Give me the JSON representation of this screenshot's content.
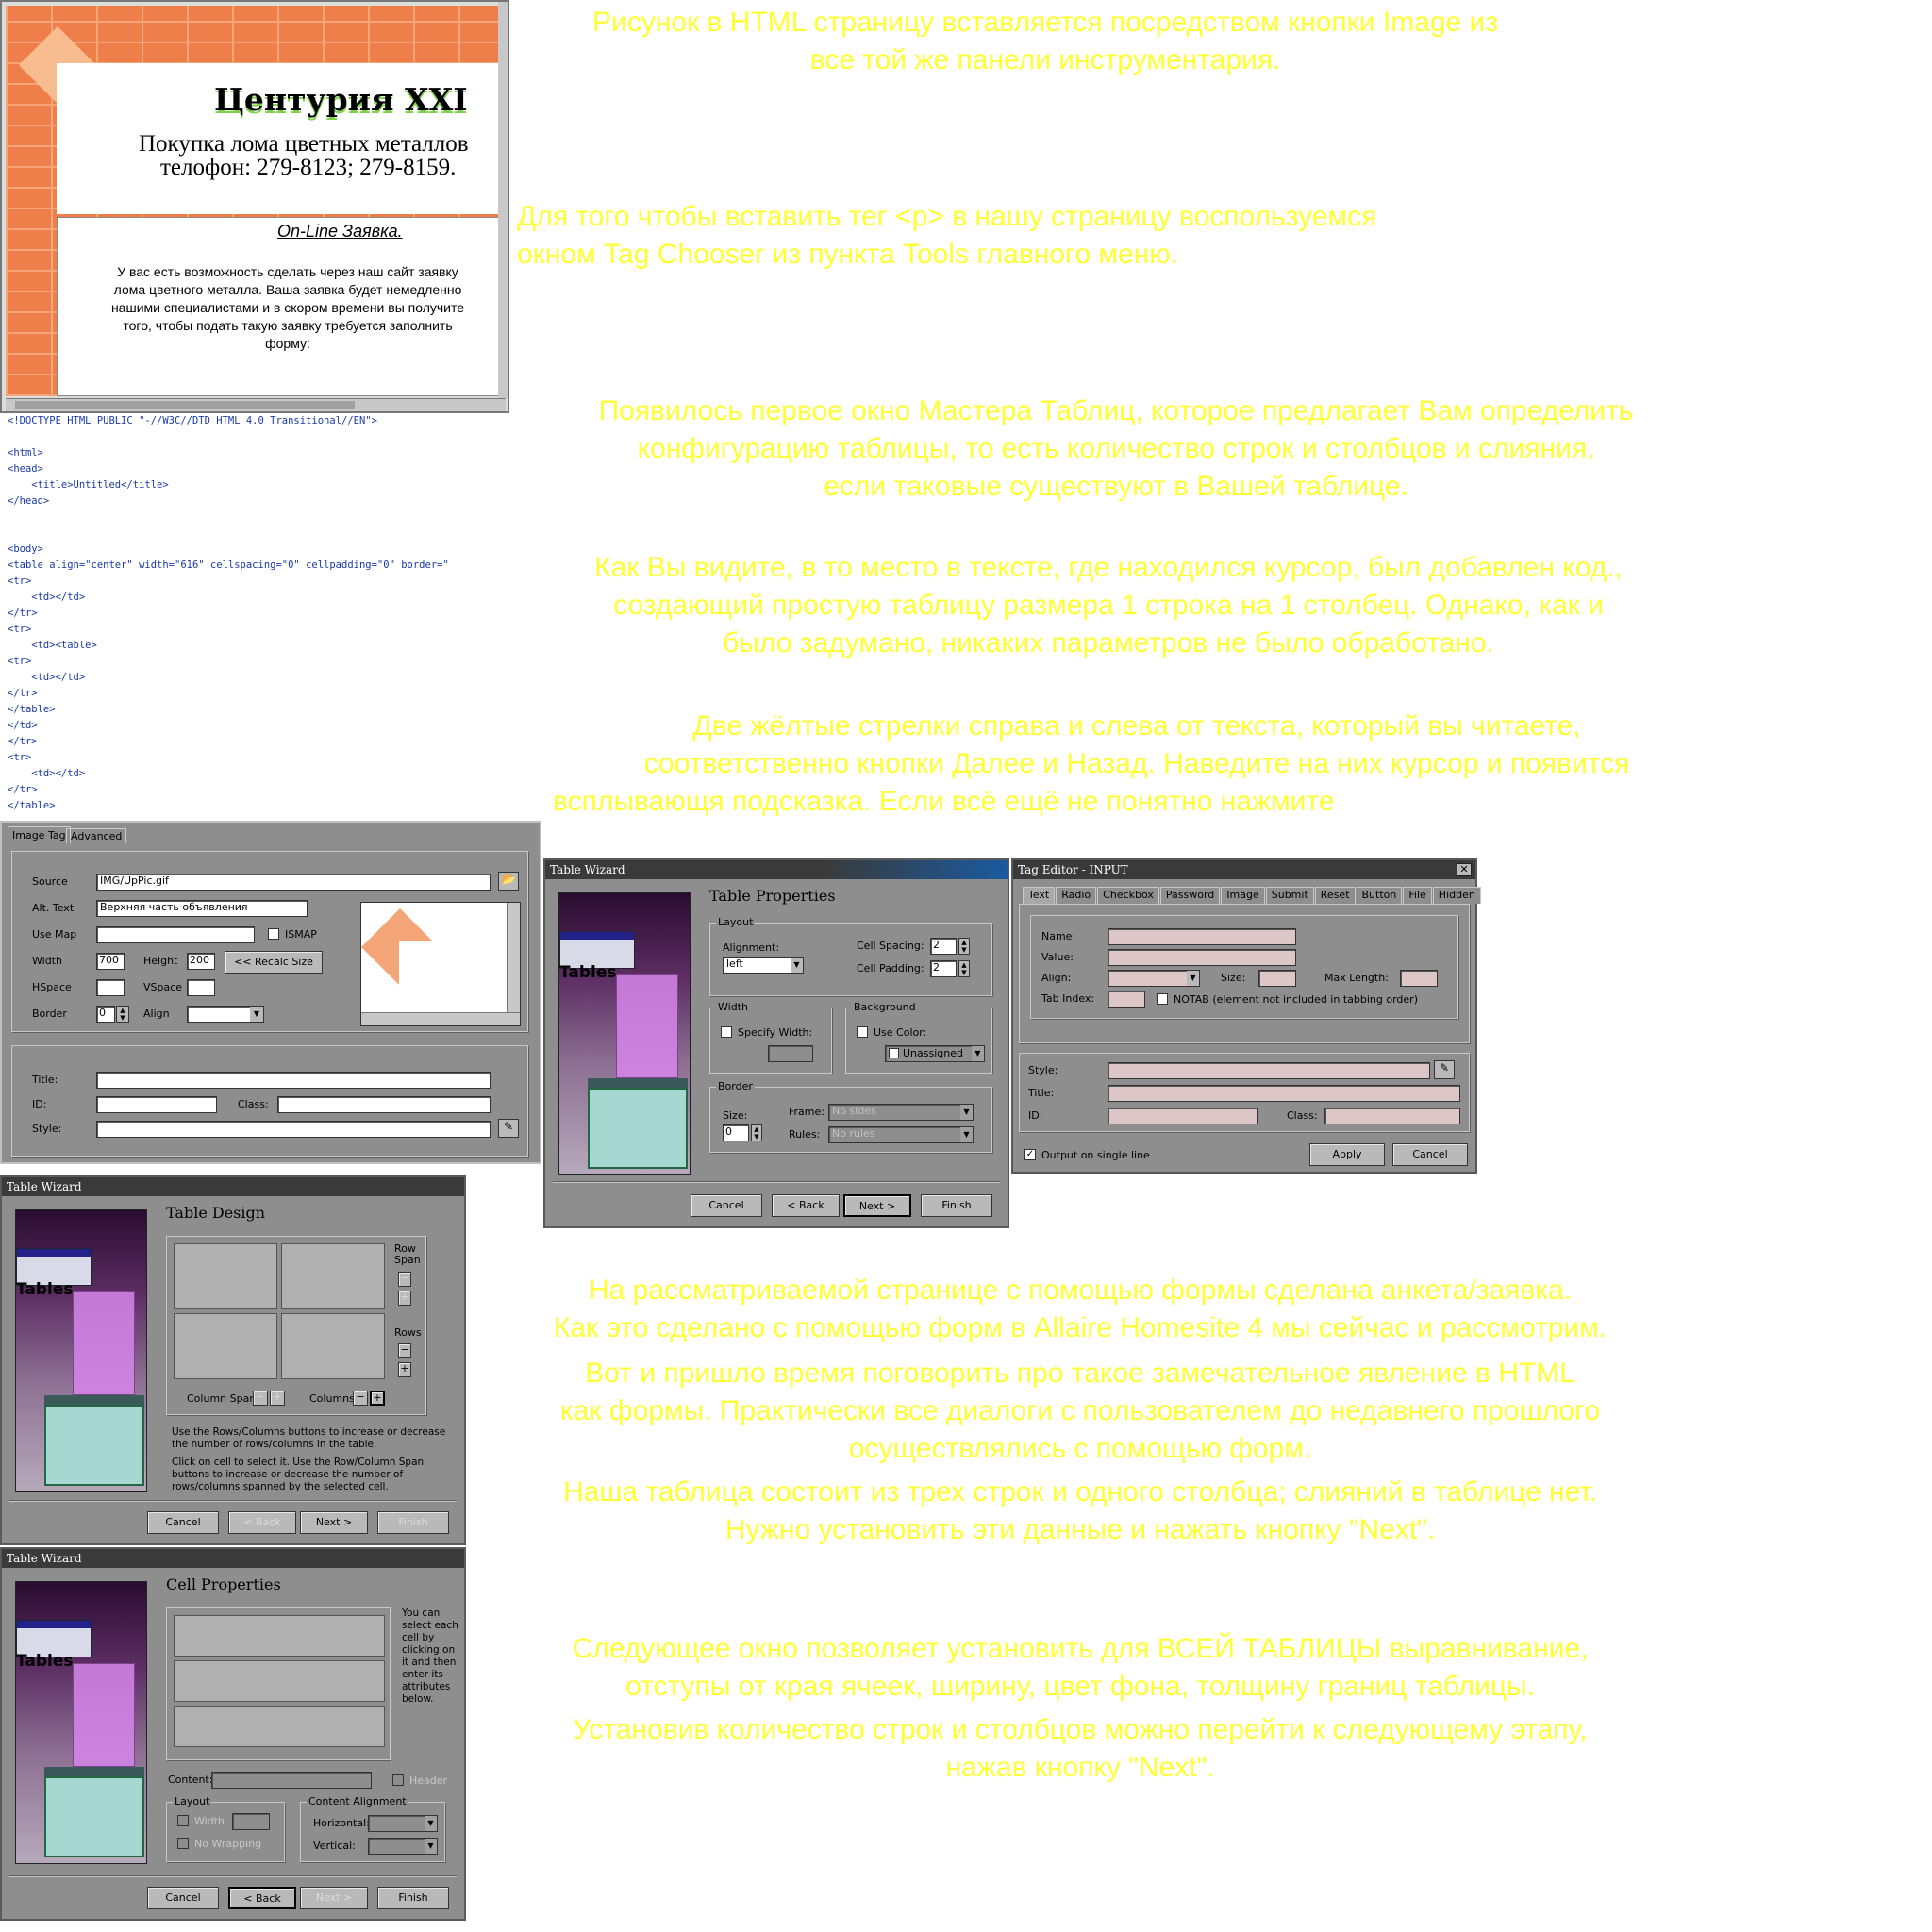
{
  "yellow_text": [
    [
      "Рисунок в HTML страницу вставляется посредством  кнопки Image из",
      "все той же панели инструментария."
    ],
    [
      "Для того чтобы вставить тег <p>  в нашу страницу воспользуемся",
      "окном Tag Chooser из пункта   Tools главного меню."
    ],
    [
      "Появилось первое окно Мастера Таблиц, которое предлагает Вам определить",
      "конфигурацию таблицы, то есть количество строк и столбцов и слияния,",
      "если таковые существуют в Вашей таблице."
    ],
    [
      "Как Вы видите, в то место в тексте, где находился курсор, был добавлен код.,",
      "создающий простую таблицу размера 1 строка на 1 столбец. Однако, как и",
      "было задумано, никаких параметров не было обработано."
    ],
    [
      "Две жёлтые стрелки справа и слева от текста, который вы читаете,",
      "соответственно кнопки Далее и Назад. Наведите на них курсор и появится",
      "всплывающя подсказка. Если  всё ещё не понятно нажмите"
    ],
    [
      "На рассматриваемой странице с помощью формы сделана анкета/заявка.",
      "Как это сделано с помощью форм в Allaire Homesite 4 мы сейчас и рассмотрим."
    ],
    [
      "Вот и пришло время поговорить про такое замечательное явление в HTML",
      "как формы. Практически все диалоги с пользователем до недавнего прошлого",
      "осуществлялись с помощью форм."
    ],
    [
      "Наша таблица состоит из трех строк и одного столбца; слияний в таблице нет.",
      "Нужно установить эти данные и нажать кнопку \"Next\"."
    ],
    [
      "Следующее окно позволяет установить для ВСЕЙ ТАБЛИЦЫ выравнивание,",
      "отступы от края ячеек, ширину, цвет фона, толщину границ таблицы."
    ],
    [
      "Установив количество строк и столбцов можно перейти к следующему этапу,",
      "нажав кнопку \"Next\"."
    ]
  ],
  "preview": {
    "title": "Центурия XXI",
    "line1": "Покупка лома цветных металлов",
    "line2": "телофон: 279-8123; 279-8159.",
    "link": "On-Line Заявка.",
    "body": [
      "У вас есть возможность сделать через наш сайт заявку",
      "лома цветного металла. Ваша заявка будет немедленно",
      "нашими специалистами и в скором времени вы получите",
      "того, чтобы подать такую заявку требуется заполнить",
      "форму:"
    ]
  },
  "code": [
    "<!DOCTYPE HTML PUBLIC \"-//W3C//DTD HTML 4.0 Transitional//EN\">",
    "",
    "<html>",
    "<head>",
    "    <title>Untitled</title>",
    "</head>",
    "",
    "",
    "<body>",
    "<table align=\"center\" width=\"616\" cellspacing=\"0\" cellpadding=\"0\" border=\"",
    "<tr>",
    "    <td></td>",
    "</tr>",
    "<tr>",
    "    <td><table>",
    "<tr>",
    "    <td></td>",
    "</tr>",
    "</table>",
    "</td>",
    "</tr>",
    "<tr>",
    "    <td></td>",
    "</tr>",
    "</table>"
  ],
  "image_tag": {
    "tabs": [
      "Image Tag",
      "Advanced"
    ],
    "source_label": "Source",
    "source_value": "IMG/UpPic.gif",
    "alt_label": "Alt. Text",
    "alt_value": "Верхняя часть объявления",
    "usemap_label": "Use Map",
    "ismap_label": "ISMAP",
    "width_label": "Width",
    "width_value": "700",
    "height_label": "Height",
    "height_value": "200",
    "recalc_label": "<<  Recalc Size",
    "hspace_label": "HSpace",
    "vspace_label": "VSpace",
    "border_label": "Border",
    "border_value": "0",
    "align_label": "Align",
    "title_label": "Title:",
    "id_label": "ID:",
    "class_label": "Class:",
    "style_label": "Style:"
  },
  "wizard_common": {
    "title": "Table Wizard",
    "art_text": "Tables",
    "cancel": "Cancel",
    "back": "< Back",
    "next": "Next >",
    "finish": "Finish"
  },
  "table_properties": {
    "heading": "Table Properties",
    "layout": "Layout",
    "alignment": "Alignment:",
    "alignment_value": "left",
    "cell_spacing": "Cell Spacing:",
    "cell_spacing_value": "2",
    "cell_padding": "Cell Padding:",
    "cell_padding_value": "2",
    "width": "Width",
    "specify_width": "Specify Width:",
    "background": "Background",
    "use_color": "Use Color:",
    "unassigned": "Unassigned",
    "border": "Border",
    "size": "Size:",
    "size_value": "0",
    "frame": "Frame:",
    "frame_value": "No sides",
    "rules": "Rules:",
    "rules_value": "No rules"
  },
  "tag_editor": {
    "title": "Tag Editor - INPUT",
    "tabs": [
      "Text",
      "Radio",
      "Checkbox",
      "Password",
      "Image",
      "Submit",
      "Reset",
      "Button",
      "File",
      "Hidden"
    ],
    "name": "Name:",
    "value": "Value:",
    "align": "Align:",
    "size": "Size:",
    "max_length": "Max Length:",
    "tab_index": "Tab Index:",
    "notab": "NOTAB (element not included in tabbing order)",
    "style": "Style:",
    "title_f": "Title:",
    "id": "ID:",
    "class": "Class:",
    "output_single": "Output on single line",
    "apply": "Apply",
    "cancel": "Cancel"
  },
  "table_design": {
    "heading": "Table Design",
    "row_span": [
      "Row",
      "Span"
    ],
    "rows": "Rows",
    "column_span": "Column Span",
    "columns": "Columns",
    "help1": [
      "Use the Rows/Columns buttons to increase or decrease",
      "the  number of rows/columns in the table."
    ],
    "help2": [
      "Click on cell to select it. Use the Row/Column Span",
      "buttons to increase or decrease the number of",
      "rows/columns spanned by the selected cell."
    ]
  },
  "cell_properties": {
    "heading": "Cell Properties",
    "help": [
      "You can",
      "select each",
      "cell by",
      "clicking on",
      "it and then",
      "enter its",
      "attributes",
      "below."
    ],
    "content": "Content:",
    "header": "Header",
    "layout": "Layout",
    "width": "Width",
    "no_wrapping": "No Wrapping",
    "content_alignment": "Content Alignment",
    "horizontal": "Horizontal:",
    "vertical": "Vertical:"
  }
}
